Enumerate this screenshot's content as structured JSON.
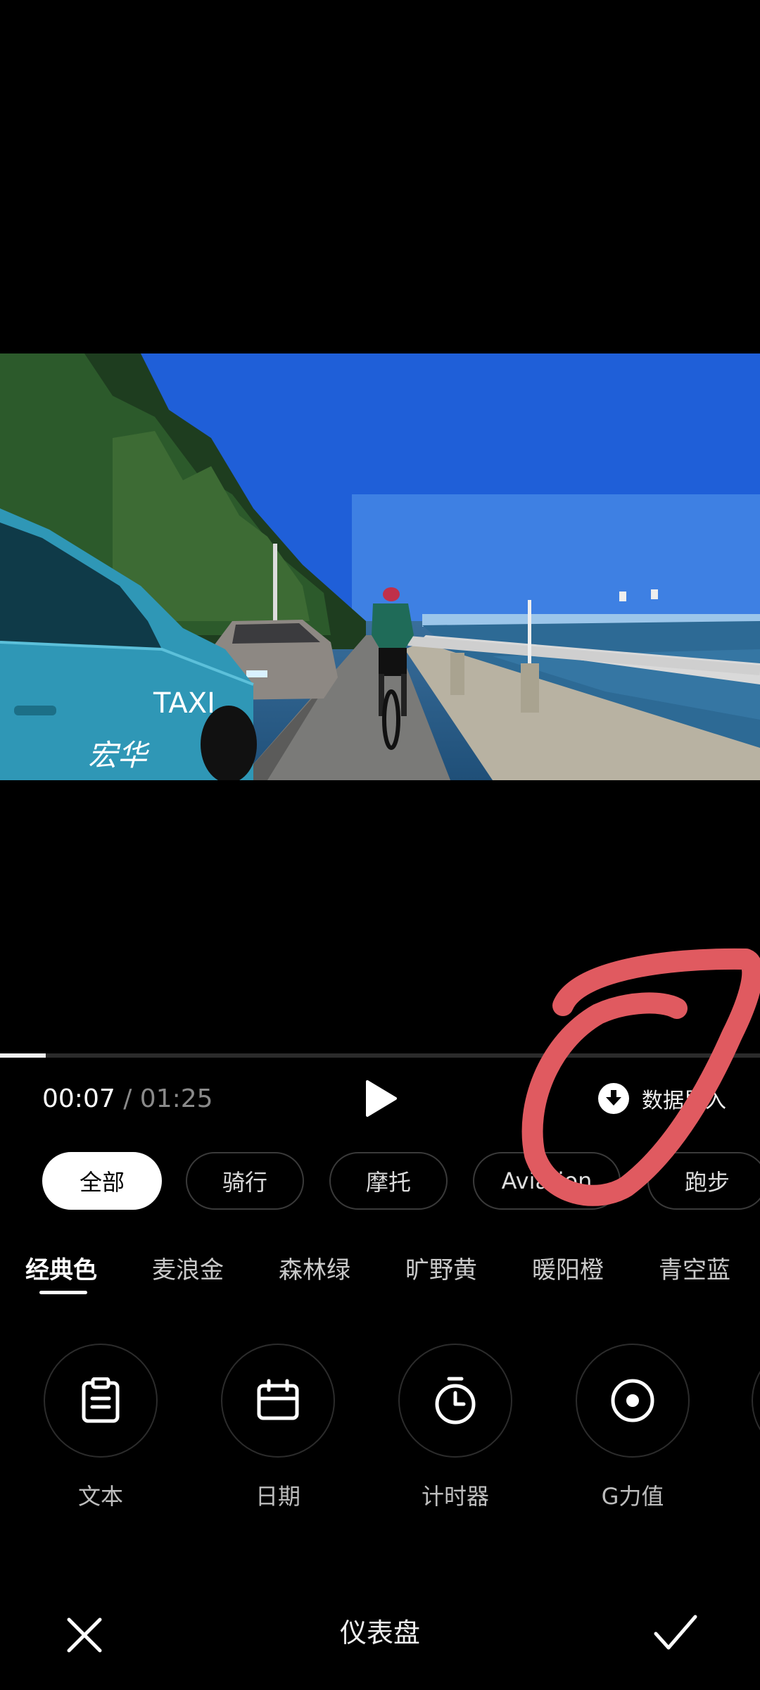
{
  "player": {
    "current_time": "00:07",
    "separator": "/",
    "total_time": "01:25",
    "progress_fraction": 0.06,
    "export_label": "数据导入"
  },
  "video": {
    "taxi_text": "TAXI",
    "taxi_company": "宏华"
  },
  "categories": [
    {
      "label": "全部",
      "active": true
    },
    {
      "label": "骑行",
      "active": false
    },
    {
      "label": "摩托",
      "active": false
    },
    {
      "label": "Aviation",
      "active": false
    },
    {
      "label": "跑步",
      "active": false
    }
  ],
  "color_tabs": [
    {
      "label": "经典色",
      "active": true
    },
    {
      "label": "麦浪金",
      "active": false
    },
    {
      "label": "森林绿",
      "active": false
    },
    {
      "label": "旷野黄",
      "active": false
    },
    {
      "label": "暖阳橙",
      "active": false
    },
    {
      "label": "青空蓝",
      "active": false
    }
  ],
  "tools": [
    {
      "label": "文本",
      "icon": "clipboard-icon"
    },
    {
      "label": "日期",
      "icon": "calendar-icon"
    },
    {
      "label": "计时器",
      "icon": "stopwatch-icon"
    },
    {
      "label": "G力值",
      "icon": "target-icon"
    }
  ],
  "bottom": {
    "title": "仪表盘"
  },
  "colors": {
    "background": "#000000",
    "annotation": "#e05a60",
    "chip_border": "#3a3a3a"
  }
}
